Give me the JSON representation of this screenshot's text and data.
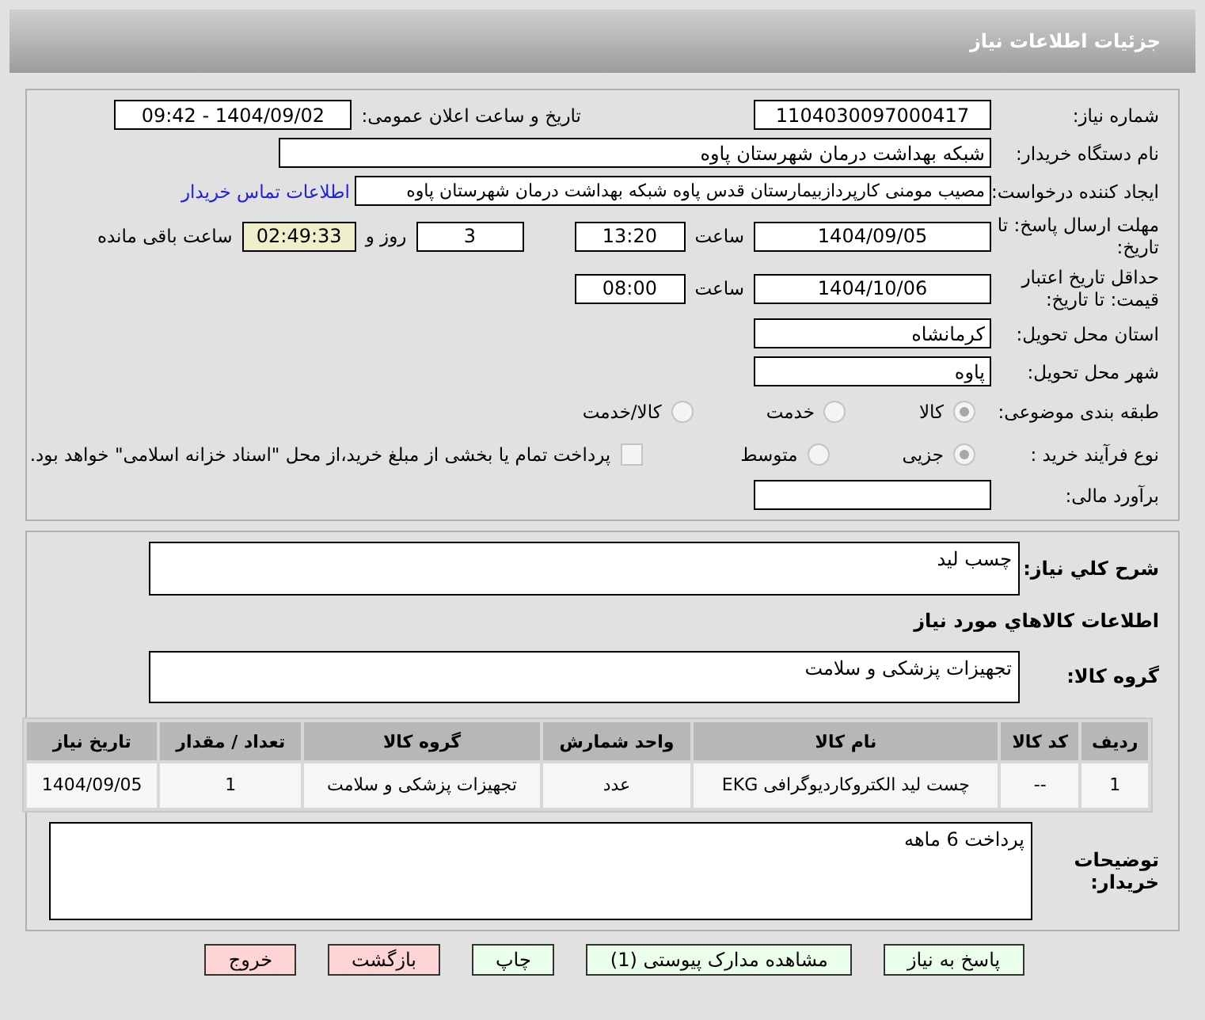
{
  "header": {
    "title": "جزئیات اطلاعات نیاز"
  },
  "need_number": {
    "label": "شماره نیاز:",
    "value": "1104030097000417"
  },
  "announce": {
    "label": "تاریخ و ساعت اعلان عمومی:",
    "value": "1404/09/02 - 09:42"
  },
  "buyer_org": {
    "label": "نام دستگاه خریدار:",
    "value": "شبکه بهداشت درمان شهرستان پاوه"
  },
  "requester": {
    "label": "ایجاد کننده درخواست:",
    "value": "مصیب مومنی کارپردازبیمارستان قدس پاوه شبکه بهداشت درمان شهرستان پاوه",
    "link": "اطلاعات تماس خریدار"
  },
  "deadline": {
    "label": "مهلت ارسال پاسخ: تا تاریخ:",
    "date": "1404/09/05",
    "time_label": "ساعت",
    "time": "13:20",
    "days": "3",
    "days_label": "روز و",
    "remaining": "02:49:33",
    "remaining_label": "ساعت باقی مانده"
  },
  "validity": {
    "label": "حداقل تاریخ اعتبار قیمت: تا تاریخ:",
    "date": "1404/10/06",
    "time_label": "ساعت",
    "time": "08:00"
  },
  "province": {
    "label": "استان محل تحویل:",
    "value": "کرمانشاه"
  },
  "city": {
    "label": "شهر محل تحویل:",
    "value": "پاوه"
  },
  "category": {
    "label": "طبقه بندی موضوعی:",
    "disabled": true,
    "options": [
      {
        "label": "کالا",
        "selected": true
      },
      {
        "label": "خدمت",
        "selected": false
      },
      {
        "label": "کالا/خدمت",
        "selected": false
      }
    ]
  },
  "process": {
    "label": "نوع فرآیند خرید :",
    "disabled": true,
    "options": [
      {
        "label": "جزیی",
        "selected": true
      },
      {
        "label": "متوسط",
        "selected": false
      }
    ],
    "treasury": {
      "label": "پرداخت تمام یا بخشی از مبلغ خرید،از محل \"اسناد خزانه اسلامی\" خواهد بود.",
      "checked": false
    }
  },
  "estimate": {
    "label": "برآورد مالی:"
  },
  "description": {
    "label": "شرح کلي نياز:",
    "value": "چسب لید"
  },
  "goods_title": "اطلاعات کالاهاي مورد نياز",
  "goods_group": {
    "label": "گروه کالا:",
    "value": "تجهیزات پزشکی و سلامت"
  },
  "table": {
    "columns": [
      "ردیف",
      "کد کالا",
      "نام کالا",
      "واحد شمارش",
      "گروه کالا",
      "تعداد / مقدار",
      "تاریخ نیاز"
    ],
    "rows": [
      [
        "1",
        "--",
        "چست لید الکتروکاردیوگرافی EKG",
        "عدد",
        "تجهیزات پزشکی و سلامت",
        "1",
        "1404/09/05"
      ]
    ]
  },
  "buyer_notes": {
    "label": "توضیحات خریدار:",
    "value": "پرداخت 6 ماهه"
  },
  "buttons": [
    {
      "label": "پاسخ به نیاز",
      "kind": "normal"
    },
    {
      "label": "مشاهده مدارک پیوستی (1)",
      "kind": "normal"
    },
    {
      "label": "چاپ",
      "kind": "normal"
    },
    {
      "label": "بازگشت",
      "kind": "danger"
    },
    {
      "label": "خروج",
      "kind": "danger"
    }
  ]
}
